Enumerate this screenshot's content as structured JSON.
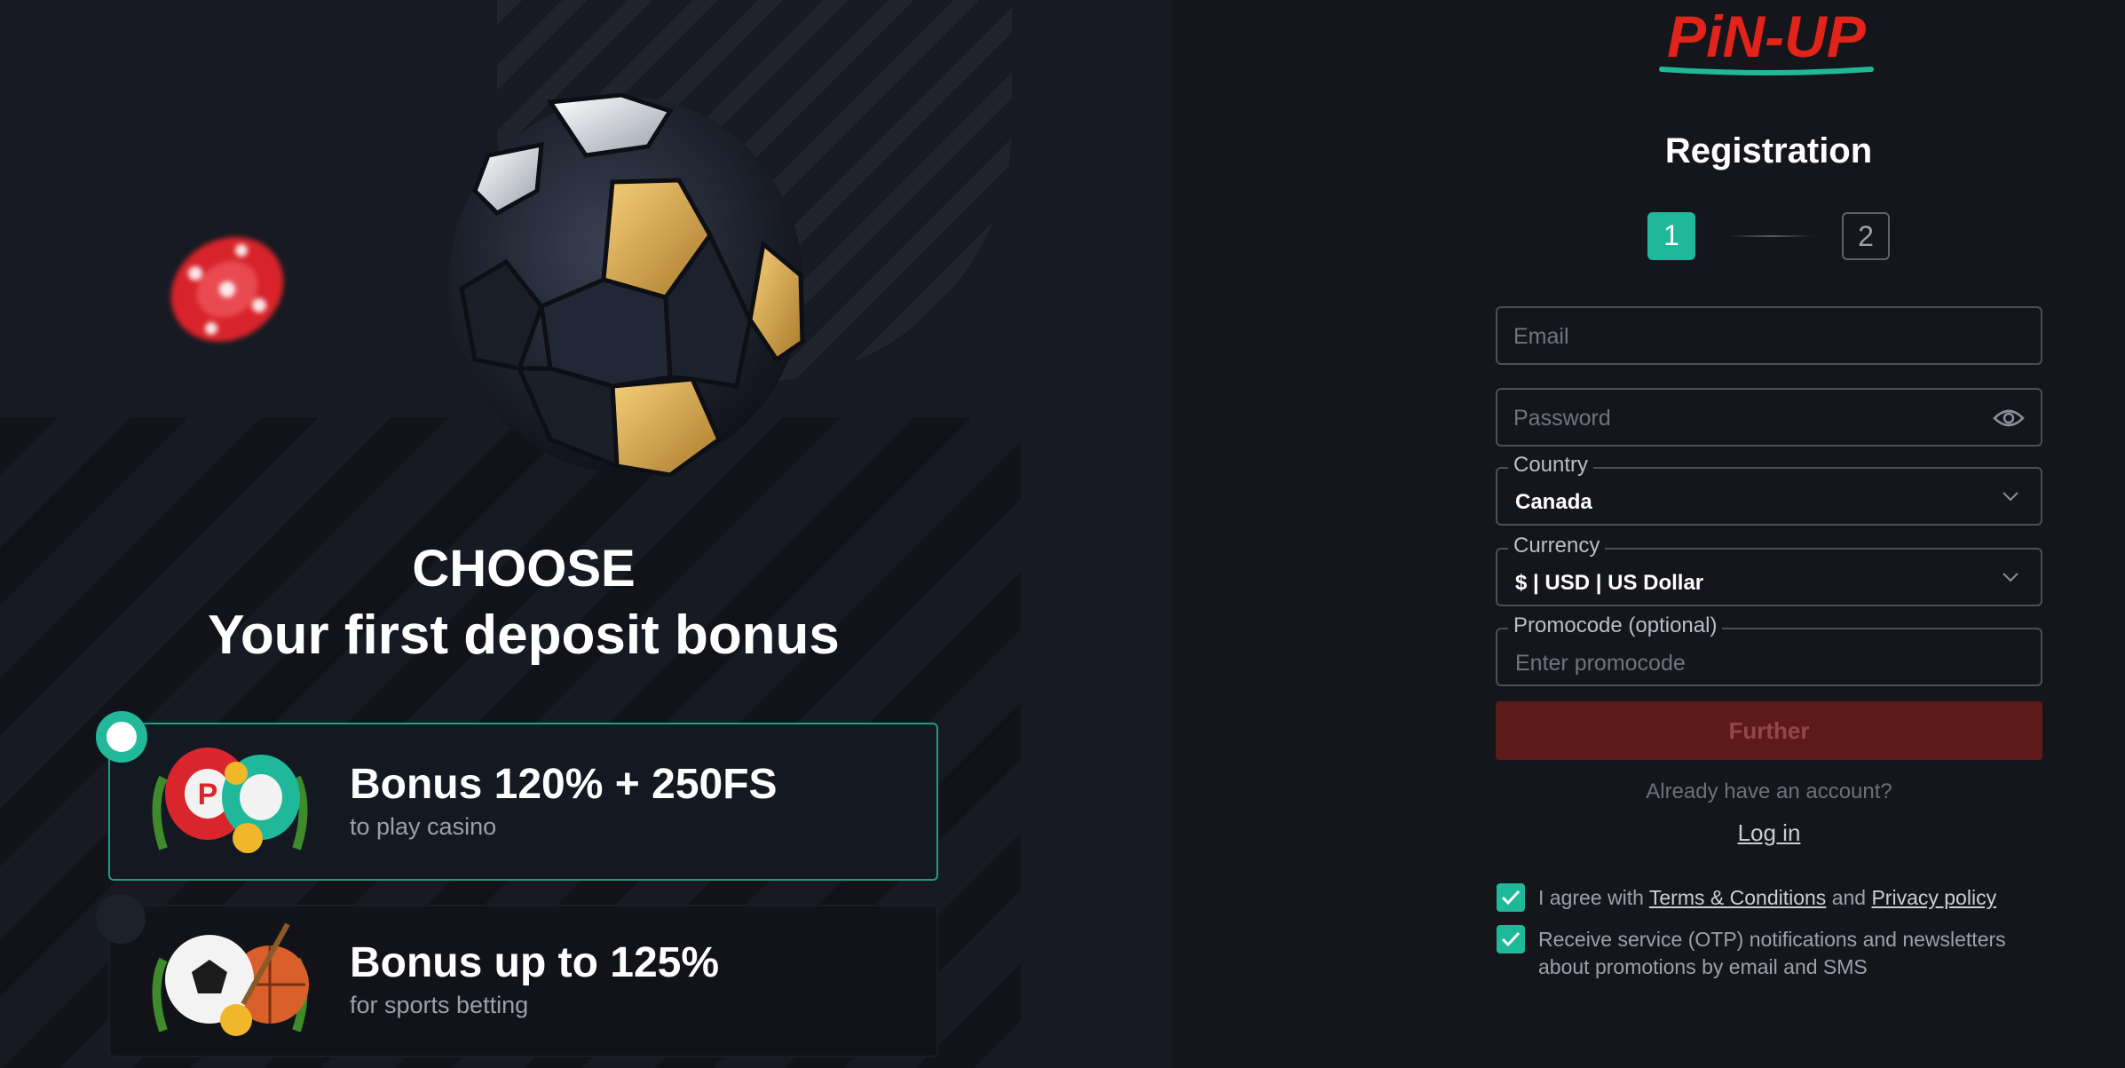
{
  "promo": {
    "headline_line1": "CHOOSE",
    "headline_line2": "Your first deposit bonus",
    "bonuses": [
      {
        "title": "Bonus 120% + 250FS",
        "subtitle": "to play casino",
        "selected": true
      },
      {
        "title": "Bonus up to 125%",
        "subtitle": "for sports betting",
        "selected": false
      }
    ]
  },
  "brand": {
    "logo_text": "PiN-UP",
    "logo_color": "#e2231a",
    "accent_color": "#1fb999"
  },
  "registration": {
    "title": "Registration",
    "steps": [
      "1",
      "2"
    ],
    "current_step": 1,
    "email": {
      "placeholder": "Email",
      "value": ""
    },
    "password": {
      "placeholder": "Password",
      "value": ""
    },
    "country": {
      "label": "Country",
      "value": "Canada"
    },
    "currency": {
      "label": "Currency",
      "value": "$ | USD | US Dollar"
    },
    "promocode": {
      "label": "Promocode (optional)",
      "placeholder": "Enter promocode"
    },
    "further_label": "Further",
    "already_text": "Already have an account?",
    "login_label": "Log in",
    "agree_prefix": "I agree with",
    "terms_link": "Terms & Conditions",
    "agree_and": "and",
    "privacy_link": "Privacy policy",
    "notifications_text": "Receive service (OTP) notifications and newsletters about promotions by email and SMS",
    "agree_checked": true,
    "notifications_checked": true
  }
}
